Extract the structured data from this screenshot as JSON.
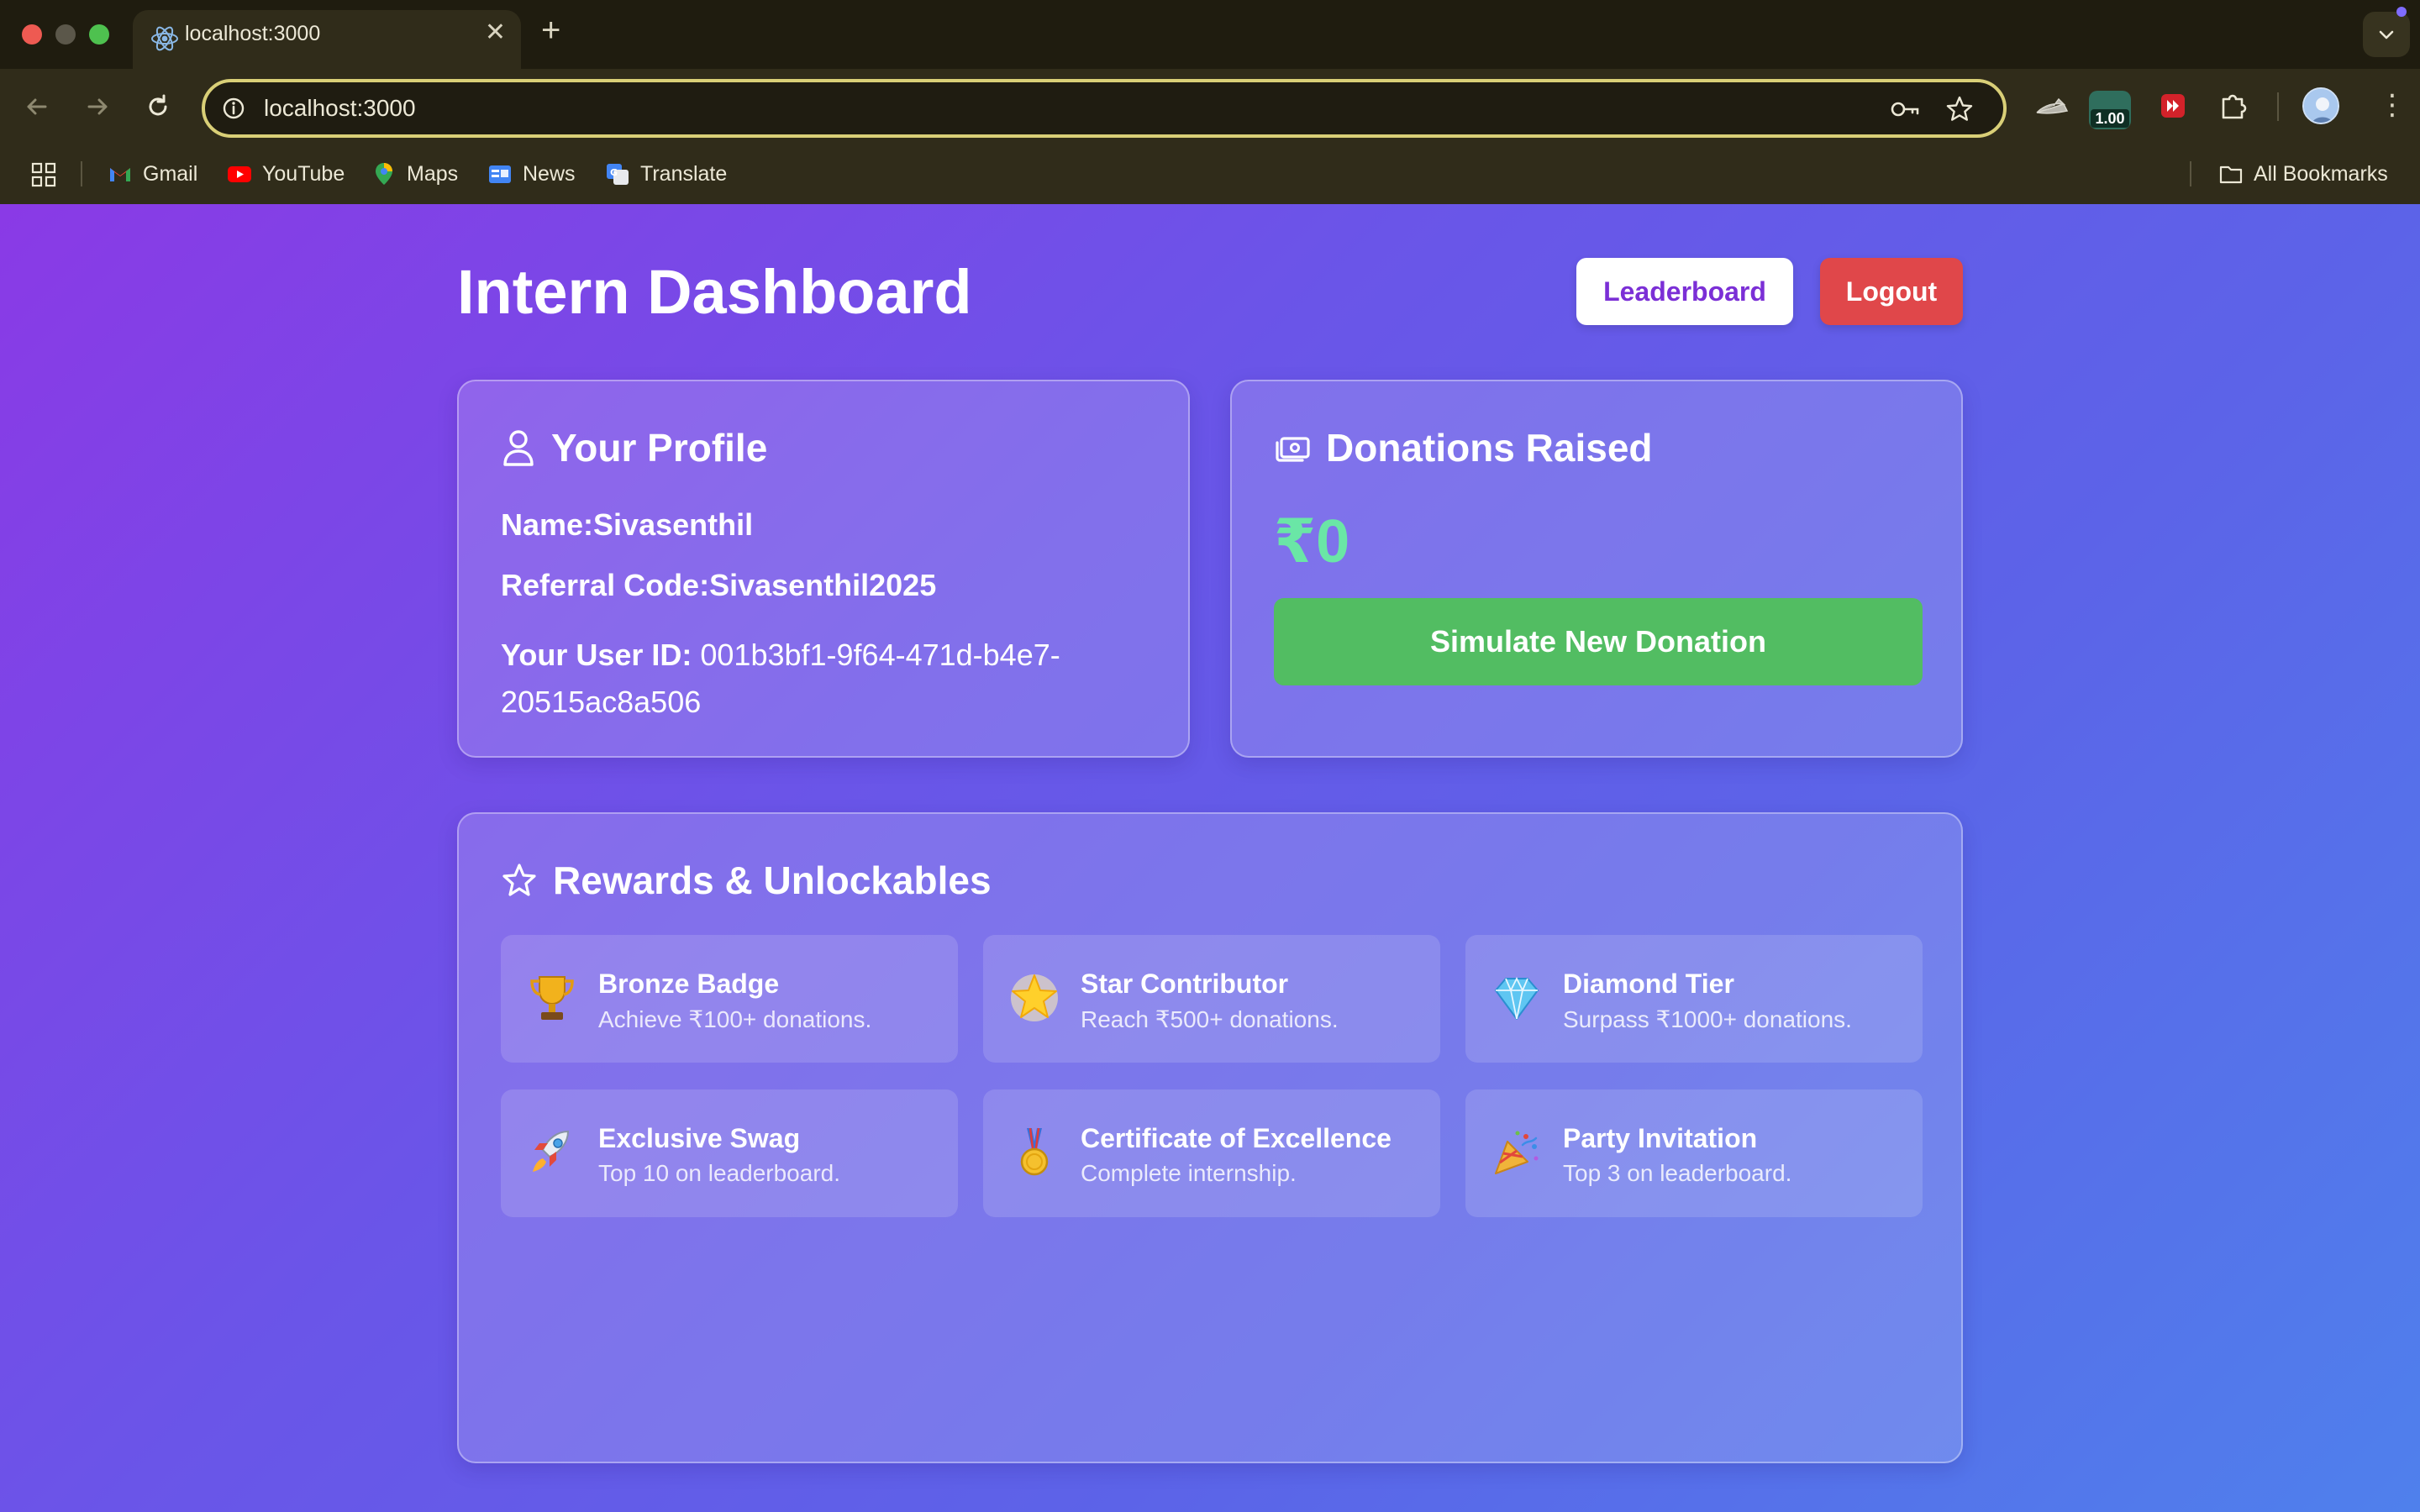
{
  "browser": {
    "tab_title": "localhost:3000",
    "tab_close": "✕",
    "new_tab": "+",
    "url": "localhost:3000",
    "extension_badge": "1.00",
    "kebab": "⋮",
    "bookmarks": [
      {
        "label": "Gmail",
        "icon": "gmail-icon"
      },
      {
        "label": "YouTube",
        "icon": "youtube-icon"
      },
      {
        "label": "Maps",
        "icon": "maps-icon"
      },
      {
        "label": "News",
        "icon": "news-icon"
      },
      {
        "label": "Translate",
        "icon": "translate-icon"
      }
    ],
    "all_bookmarks": "All Bookmarks"
  },
  "header": {
    "title": "Intern Dashboard",
    "leaderboard_label": "Leaderboard",
    "logout_label": "Logout"
  },
  "profile": {
    "heading": "Your Profile",
    "name_label": "Name:",
    "name_value": "Sivasenthil",
    "referral_label": "Referral Code:",
    "referral_value": "Sivasenthil2025",
    "userid_label": "Your User ID:",
    "userid_value": "001b3bf1-9f64-471d-b4e7-20515ac8a506"
  },
  "donations": {
    "heading": "Donations Raised",
    "amount": "₹0",
    "simulate_label": "Simulate New Donation"
  },
  "rewards": {
    "heading": "Rewards & Unlockables",
    "items": [
      {
        "title": "Bronze Badge",
        "desc": "Achieve ₹100+ donations.",
        "icon": "trophy-icon"
      },
      {
        "title": "Star Contributor",
        "desc": "Reach ₹500+ donations.",
        "icon": "glowing-star-icon"
      },
      {
        "title": "Diamond Tier",
        "desc": "Surpass ₹1000+ donations.",
        "icon": "gem-icon"
      },
      {
        "title": "Exclusive Swag",
        "desc": "Top 10 on leaderboard.",
        "icon": "rocket-icon"
      },
      {
        "title": "Certificate of Excellence",
        "desc": "Complete internship.",
        "icon": "medal-icon"
      },
      {
        "title": "Party Invitation",
        "desc": "Top 3 on leaderboard.",
        "icon": "party-popper-icon"
      }
    ]
  },
  "colors": {
    "accent_purple": "#7b2fd6",
    "logout_red": "#e0474a",
    "donate_green": "#52bd62",
    "amount_green": "#6ae6a6"
  }
}
